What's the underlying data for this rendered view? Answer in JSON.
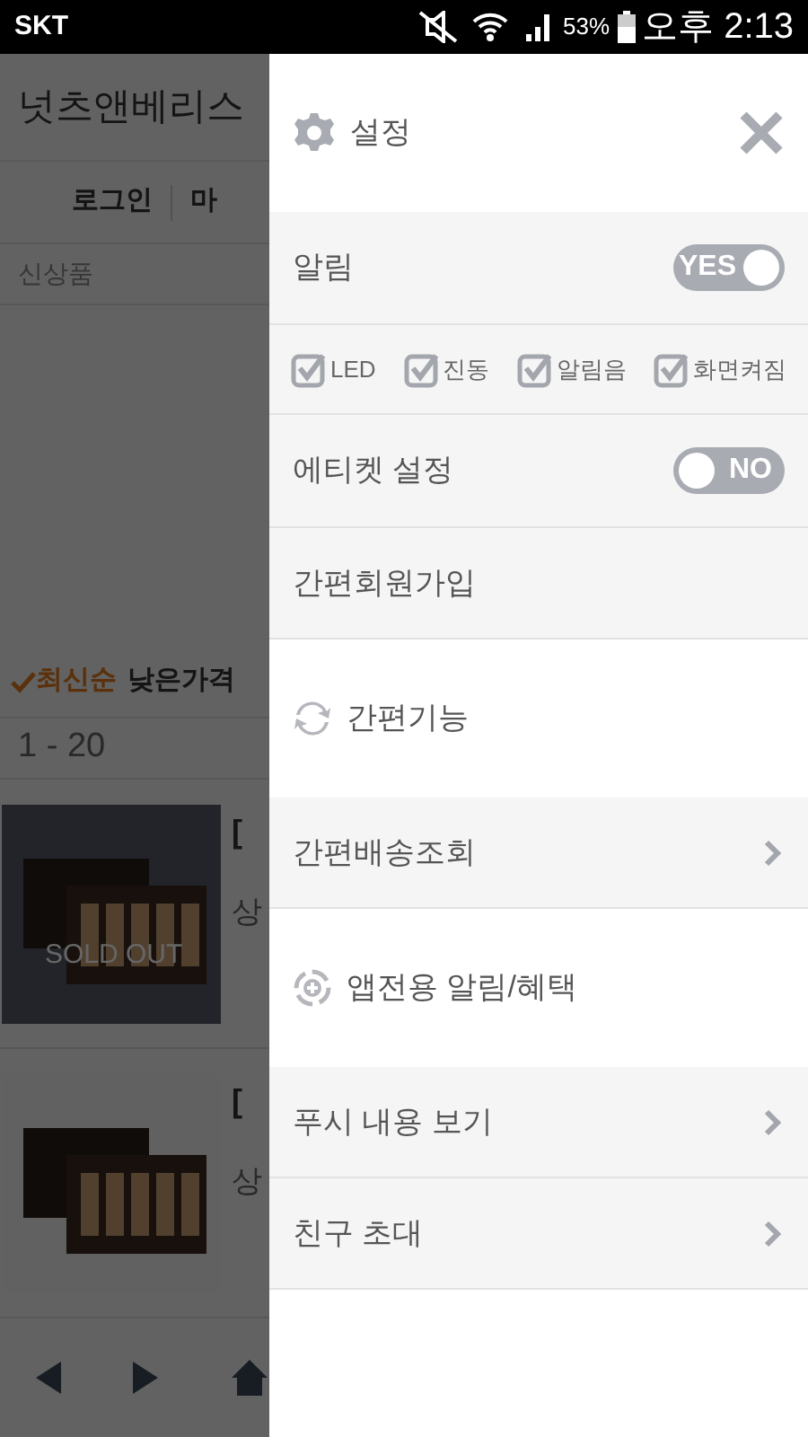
{
  "status_bar": {
    "carrier": "SKT",
    "battery": "53%",
    "time": "오후 2:13"
  },
  "page": {
    "title": "넛츠앤베리스",
    "nav": [
      {
        "label": "로그인"
      },
      {
        "label": "마"
      }
    ],
    "section": "신상품",
    "sort": [
      {
        "label": "최신순",
        "selected": true
      },
      {
        "label": "낮은가격",
        "selected": false
      }
    ],
    "count": "1 - 20",
    "products": [
      {
        "sold_out": true,
        "badge": "SOLD OUT",
        "title": "[",
        "price": "상"
      },
      {
        "sold_out": false,
        "title": "[",
        "price": "상"
      }
    ]
  },
  "drawer": {
    "title": "설정",
    "items": [
      {
        "kind": "toggle",
        "label": "알림",
        "on": true,
        "text": "YES"
      },
      {
        "kind": "checks",
        "options": [
          {
            "label": "LED",
            "checked": true
          },
          {
            "label": "진동",
            "checked": true
          },
          {
            "label": "알림음",
            "checked": true
          },
          {
            "label": "화면켜짐",
            "checked": true
          }
        ]
      },
      {
        "kind": "toggle",
        "label": "에티켓 설정",
        "on": false,
        "text": "NO"
      },
      {
        "kind": "link",
        "label": "간편회원가입",
        "arrow": false
      },
      {
        "kind": "refresh",
        "label": "간편기능"
      },
      {
        "kind": "link",
        "label": "간편배송조회",
        "arrow": true
      },
      {
        "kind": "target",
        "label": "앱전용 알림/혜택"
      },
      {
        "kind": "link",
        "label": "푸시 내용 보기",
        "arrow": true
      },
      {
        "kind": "link",
        "label": "친구 초대",
        "arrow": true
      }
    ]
  }
}
